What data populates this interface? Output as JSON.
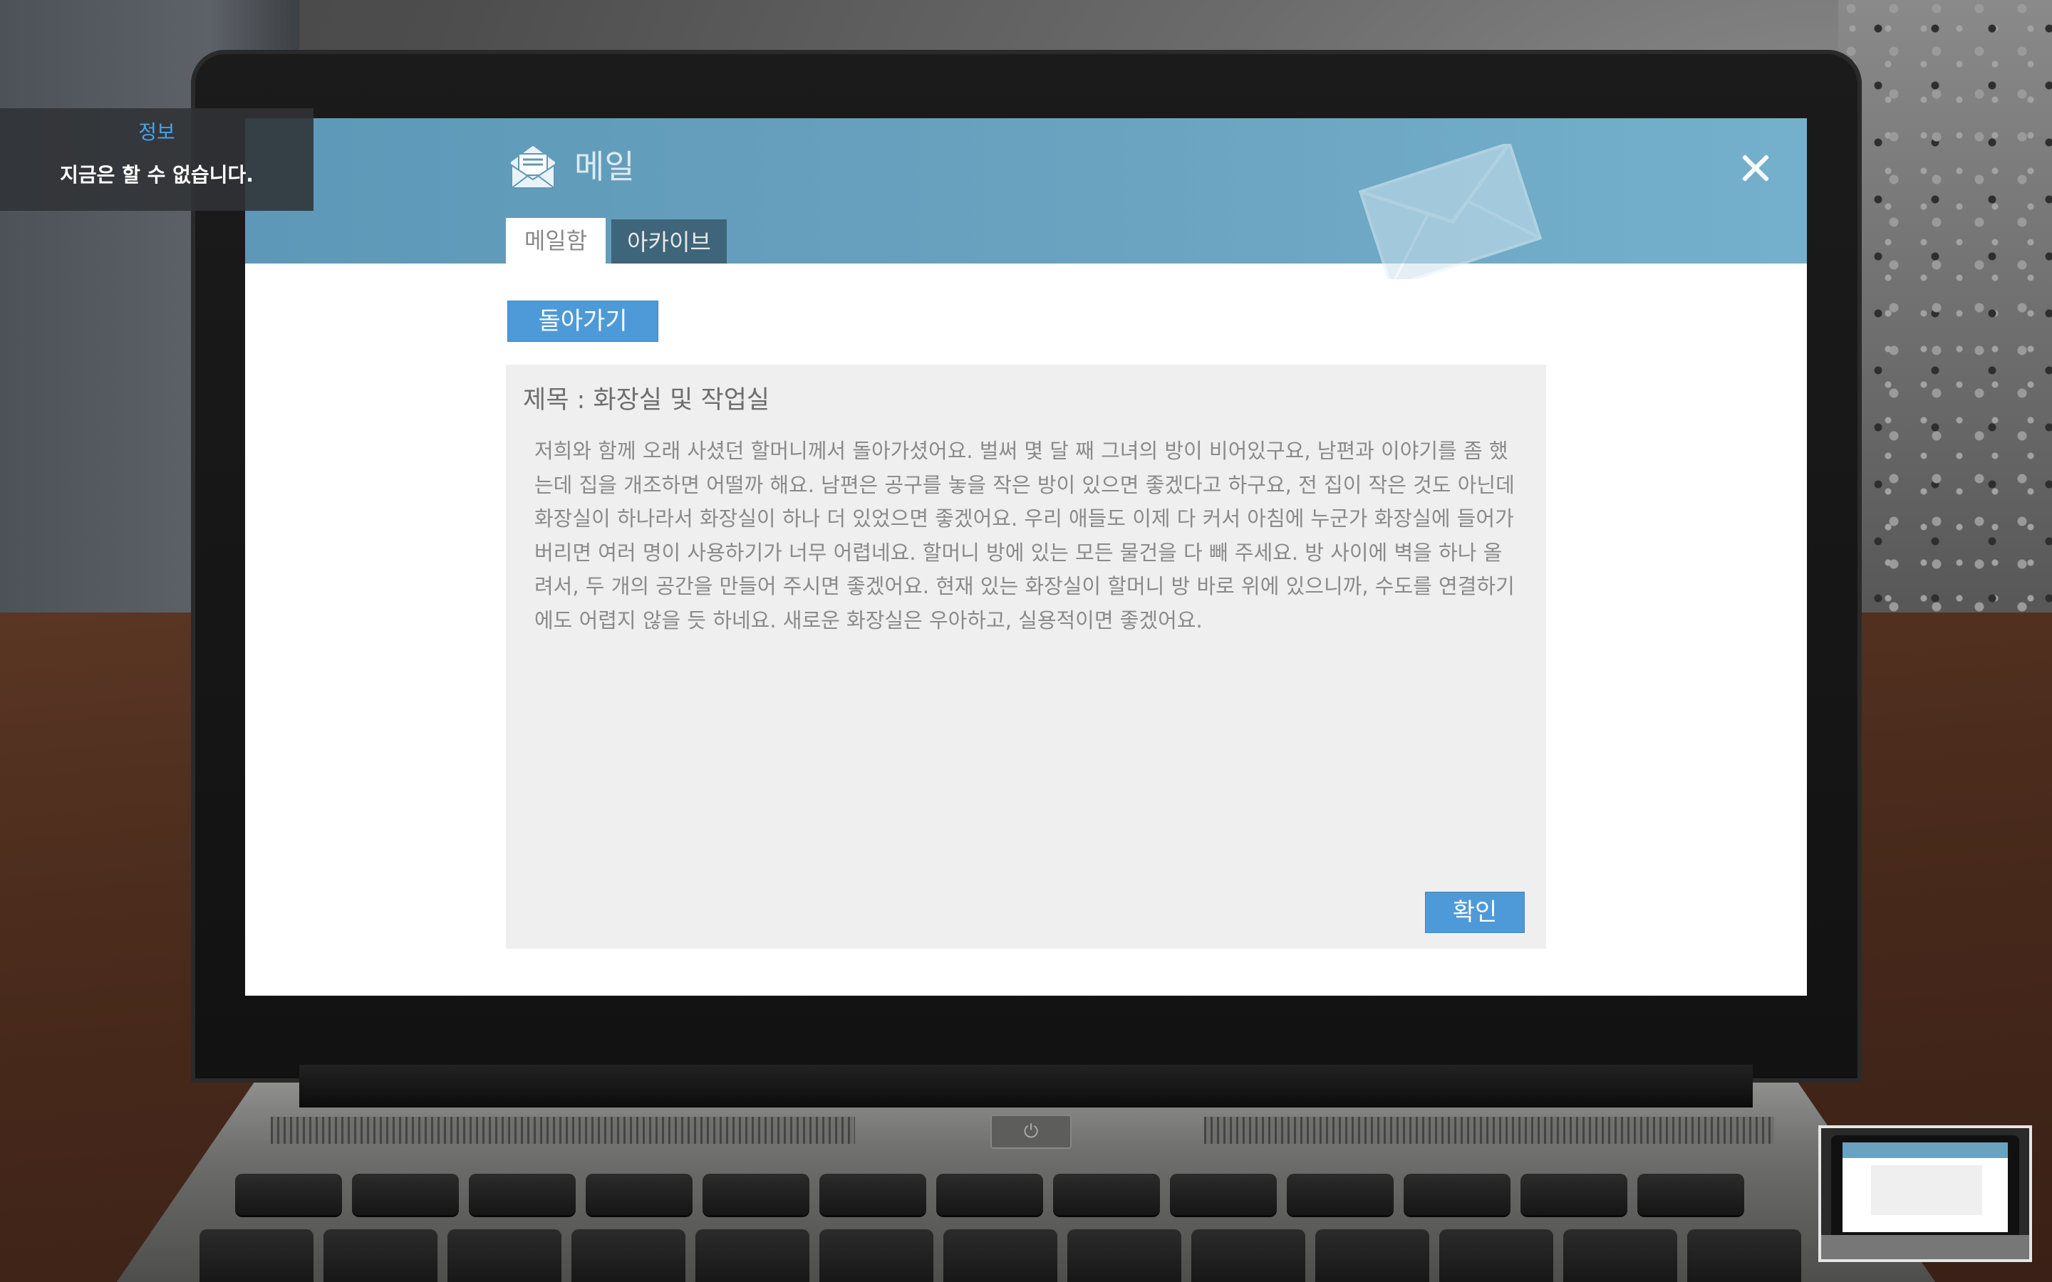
{
  "info_toast": {
    "title": "정보",
    "message": "지금은 할 수 없습니다."
  },
  "mail_app": {
    "title": "메일",
    "tabs": [
      {
        "label": "메일함",
        "active": true
      },
      {
        "label": "아카이브",
        "active": false
      }
    ],
    "back_label": "돌아가기",
    "subject": "제목 : 화장실 및 작업실",
    "body": "저희와 함께 오래 사셨던 할머니께서 돌아가셨어요. 벌써 몇 달 째 그녀의 방이 비어있구요, 남편과 이야기를 좀 했는데 집을 개조하면 어떨까 해요. 남편은 공구를 놓을 작은 방이 있으면 좋겠다고 하구요, 전 집이 작은 것도 아닌데 화장실이 하나라서 화장실이 하나 더 있었으면 좋겠어요. 우리 애들도 이제 다 커서 아침에 누군가 화장실에 들어가 버리면 여러 명이 사용하기가 너무 어렵네요. 할머니 방에 있는 모든 물건을 다 빼 주세요. 방 사이에 벽을 하나 올려서, 두 개의 공간을 만들어 주시면 좋겠어요. 현재 있는 화장실이 할머니 방 바로 위에 있으니까, 수도를 연결하기에도 어렵지 않을 듯 하네요. 새로운 화장실은 우아하고, 실용적이면 좋겠어요.",
    "confirm_label": "확인"
  },
  "keyboard": {
    "power_glyph": "⏻"
  },
  "colors": {
    "header": "#6aa3c0",
    "button": "#4e9ad8",
    "archive_tab": "#3e6579",
    "info_title": "#4aa3e0",
    "panel": "#efefef"
  },
  "icons": {
    "mail": "open-envelope-icon",
    "close": "close-icon",
    "watermark": "envelope-watermark-icon"
  }
}
